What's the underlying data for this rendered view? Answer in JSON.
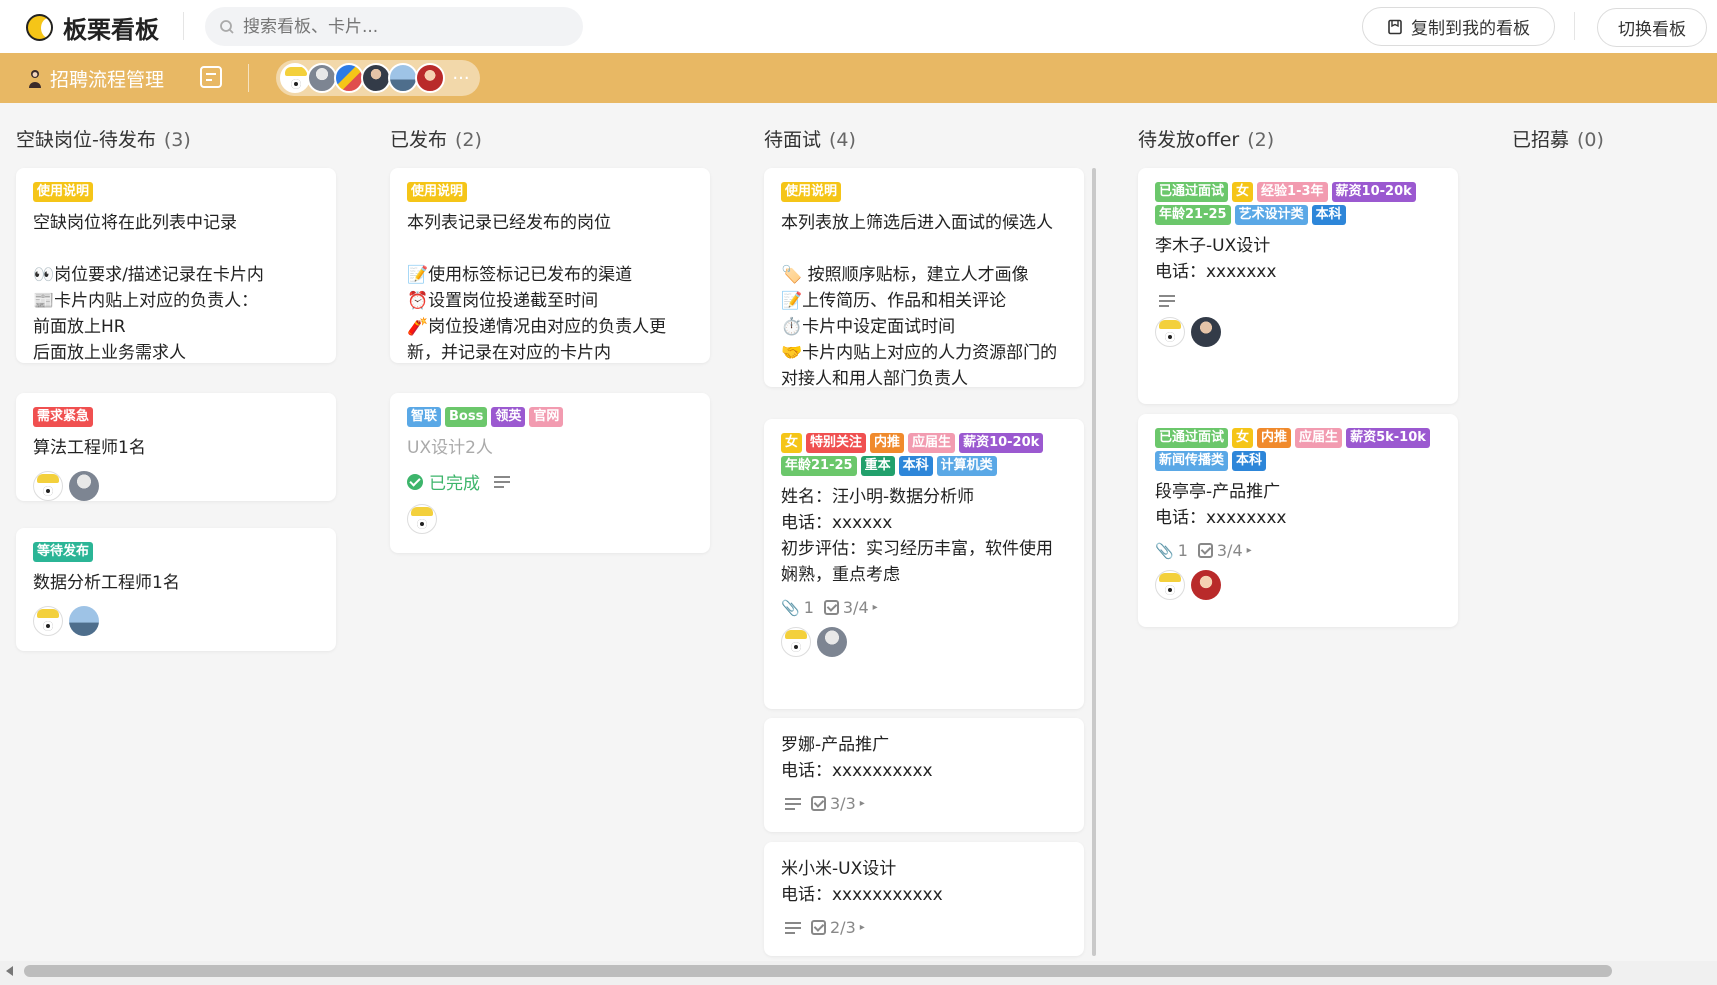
{
  "app": {
    "name": "板栗看板",
    "search_placeholder": "搜索看板、卡片...",
    "copy_button": "复制到我的看板",
    "switch_button": "切换看板"
  },
  "board": {
    "title": "招聘流程管理",
    "more_members": "···"
  },
  "tag_colors": {
    "yellow": "#f5c518",
    "red": "#f05050",
    "teal": "#2bb596",
    "sky": "#5aa8e6",
    "green": "#6bc76b",
    "purple": "#9b59d0",
    "pink": "#f29bb0",
    "orange": "#f08a2c",
    "deepgreen": "#21a06c",
    "blue": "#2d86d9"
  },
  "lists": [
    {
      "title": "空缺岗位-待发布",
      "count": "(3)",
      "cards": [
        {
          "tags": [
            {
              "label": "使用说明",
              "color": "#f5c518"
            }
          ],
          "text": "空缺岗位将在此列表中记录\n\n👀岗位要求/描述记录在卡片内\n📰卡片内贴上对应的负责人：\n前面放上HR\n后面放上业务需求人"
        },
        {
          "tags": [
            {
              "label": "需求紧急",
              "color": "#f05050"
            }
          ],
          "text": "算法工程师1名"
        },
        {
          "tags": [
            {
              "label": "等待发布",
              "color": "#2bb596"
            }
          ],
          "text": "数据分析工程师1名"
        }
      ]
    },
    {
      "title": "已发布",
      "count": "(2)",
      "cards": [
        {
          "tags": [
            {
              "label": "使用说明",
              "color": "#f5c518"
            }
          ],
          "text": "本列表记录已经发布的岗位\n\n📝使用标签标记已发布的渠道\n⏰设置岗位投递截至时间\n🧨岗位投递情况由对应的负责人更新，并记录在对应的卡片内"
        },
        {
          "tags": [
            {
              "label": "智联",
              "color": "#5aa8e6"
            },
            {
              "label": "Boss",
              "color": "#6bc76b"
            },
            {
              "label": "领英",
              "color": "#9b59d0"
            },
            {
              "label": "官网",
              "color": "#f29bb0"
            }
          ],
          "text": "UX设计2人",
          "status": "已完成"
        }
      ]
    },
    {
      "title": "待面试",
      "count": "(4)",
      "cards": [
        {
          "tags": [
            {
              "label": "使用说明",
              "color": "#f5c518"
            }
          ],
          "text": "本列表放上筛选后进入面试的候选人\n\n🏷️ 按照顺序贴标，建立人才画像\n📝上传简历、作品和相关评论\n⏱️卡片中设定面试时间\n🤝卡片内贴上对应的人力资源部门的对接人和用人部门负责人"
        },
        {
          "tags": [
            {
              "label": "女",
              "color": "#f5c518"
            },
            {
              "label": "特别关注",
              "color": "#f05050"
            },
            {
              "label": "内推",
              "color": "#f08a2c"
            },
            {
              "label": "应届生",
              "color": "#f29bb0"
            },
            {
              "label": "薪资10-20k",
              "color": "#9b59d0"
            },
            {
              "label": "年龄21-25",
              "color": "#6bc76b"
            },
            {
              "label": "重本",
              "color": "#21a06c"
            },
            {
              "label": "本科",
              "color": "#2d86d9"
            },
            {
              "label": "计算机类",
              "color": "#5aa8e6"
            }
          ],
          "text": "姓名：汪小明-数据分析师\n电话：xxxxxx\n初步评估：实习经历丰富，软件使用娴熟，重点考虑",
          "attachments": "1",
          "checklist": "3/4"
        },
        {
          "tags": [],
          "text": "罗娜-产品推广\n电话：xxxxxxxxxx",
          "checklist": "3/3"
        },
        {
          "tags": [],
          "text": "米小米-UX设计\n电话：xxxxxxxxxxx",
          "checklist": "2/3"
        }
      ]
    },
    {
      "title": "待发放offer",
      "count": "(2)",
      "cards": [
        {
          "tags": [
            {
              "label": "已通过面试",
              "color": "#6bc76b"
            },
            {
              "label": "女",
              "color": "#f5c518"
            },
            {
              "label": "经验1-3年",
              "color": "#f29bb0"
            },
            {
              "label": "薪资10-20k",
              "color": "#9b59d0"
            },
            {
              "label": "年龄21-25",
              "color": "#6bc76b"
            },
            {
              "label": "艺术设计类",
              "color": "#5aa8e6"
            },
            {
              "label": "本科",
              "color": "#2d86d9"
            }
          ],
          "text": "李木子-UX设计\n电话：xxxxxxx"
        },
        {
          "tags": [
            {
              "label": "已通过面试",
              "color": "#6bc76b"
            },
            {
              "label": "女",
              "color": "#f5c518"
            },
            {
              "label": "内推",
              "color": "#f08a2c"
            },
            {
              "label": "应届生",
              "color": "#f29bb0"
            },
            {
              "label": "薪资5k-10k",
              "color": "#9b59d0"
            },
            {
              "label": "新闻传播类",
              "color": "#5aa8e6"
            },
            {
              "label": "本科",
              "color": "#2d86d9"
            }
          ],
          "text": "段亭亭-产品推广\n电话：xxxxxxxx",
          "attachments": "1",
          "checklist": "3/4"
        }
      ]
    },
    {
      "title": "已招募",
      "count": "(0)",
      "cards": []
    }
  ]
}
